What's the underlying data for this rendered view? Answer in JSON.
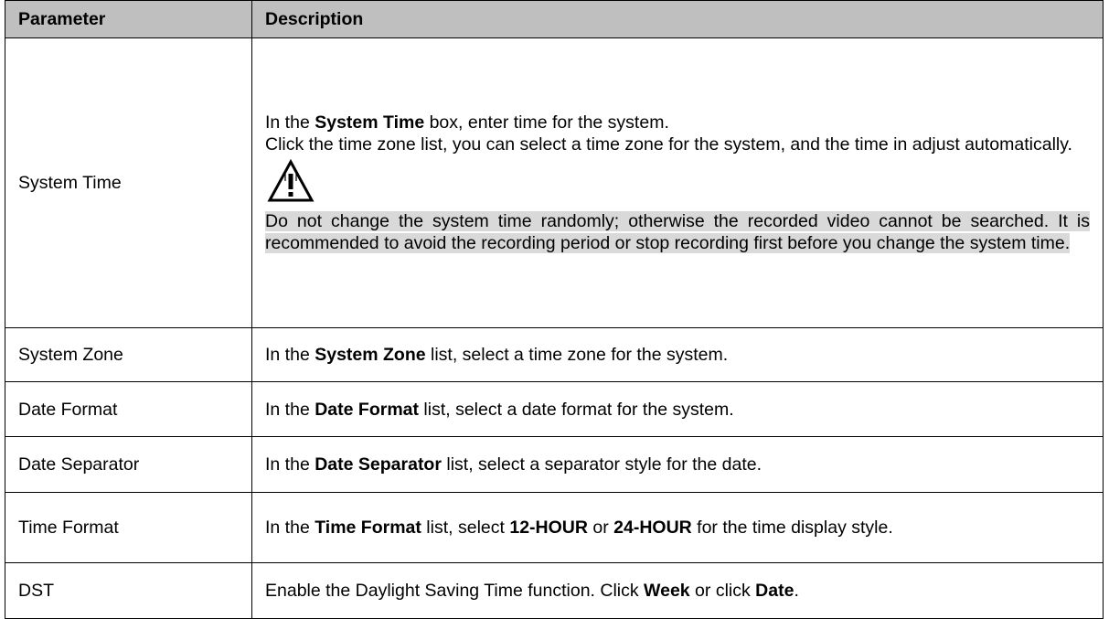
{
  "header": {
    "parameter": "Parameter",
    "description": "Description"
  },
  "rows": {
    "system_time": {
      "param": "System Time",
      "line1_pre": "In the ",
      "line1_bold": "System Time",
      "line1_post": " box, enter time for the system.",
      "line2": "Click the time zone list, you can select a time zone for the system, and the time in adjust automatically.",
      "note_icon": "warning-triangle-icon",
      "note": "Do not change the system time randomly; otherwise the recorded video cannot be searched. It is recommended to avoid the recording period or stop recording first before you change the system time."
    },
    "system_zone": {
      "param": "System Zone",
      "pre": "In the ",
      "bold": "System Zone",
      "post": " list, select a time zone for the system."
    },
    "date_format": {
      "param": "Date Format",
      "pre": "In the ",
      "bold": "Date Format",
      "post": " list, select a date format for the system."
    },
    "date_separator": {
      "param": "Date Separator",
      "pre": "In the ",
      "bold": "Date Separator",
      "post": " list, select a separator style for the date."
    },
    "time_format": {
      "param": "Time Format",
      "pre": "In the ",
      "bold1": "Time Format",
      "mid1": " list, select ",
      "bold2": "12-HOUR",
      "mid2": " or ",
      "bold3": "24-HOUR",
      "post": " for the time display style."
    },
    "dst": {
      "param": "DST",
      "pre": "Enable the Daylight Saving Time function. Click ",
      "bold1": "Week",
      "mid": " or click ",
      "bold2": "Date",
      "post": "."
    }
  }
}
